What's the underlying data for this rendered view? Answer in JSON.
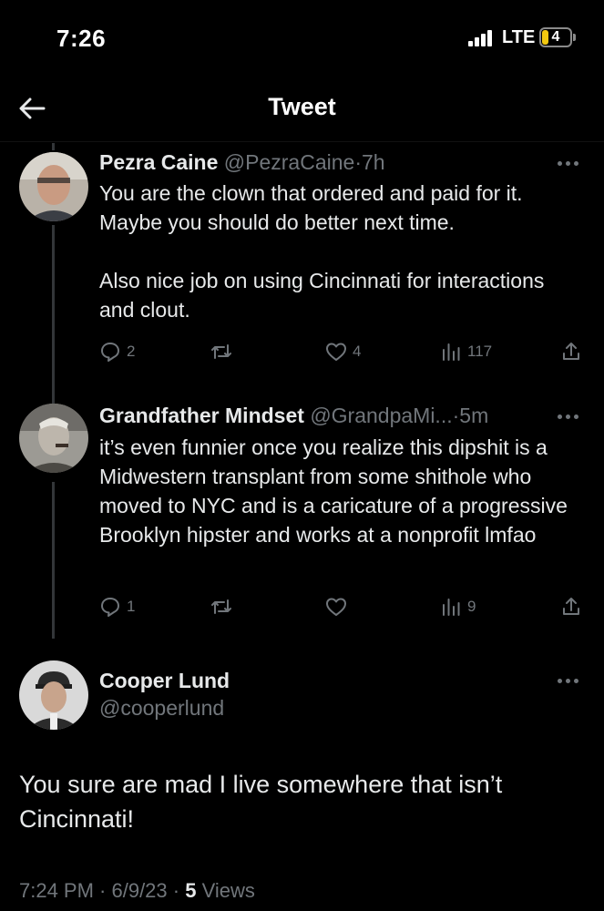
{
  "status_bar": {
    "time": "7:26",
    "network": "LTE",
    "battery": "4",
    "battery_color": "#f2c811"
  },
  "header": {
    "back_icon": "arrow-left-icon",
    "title": "Tweet"
  },
  "replies": [
    {
      "name": "Pezra Caine",
      "handle": "@PezraCaine",
      "time": "7h",
      "text": "You are the clown that ordered and paid for it. Maybe you should do better next time.\n\nAlso nice job on using Cincinnati for interactions and clout.",
      "replies": "2",
      "retweets": "",
      "likes": "4",
      "views": "117"
    },
    {
      "name": "Grandfather Mindset",
      "handle": "@GrandpaMi...",
      "time": "5m",
      "text": "it’s even funnier once you realize this dipshit is a Midwestern transplant from some shithole who moved to NYC and is a caricature of a progressive Brooklyn hipster and works at a nonprofit lmfao",
      "replies": "1",
      "retweets": "",
      "likes": "",
      "views": "9"
    }
  ],
  "main_tweet": {
    "name": "Cooper Lund",
    "handle": "@cooperlund",
    "text": "You sure are mad I live somewhere that isn’t Cincinnati!",
    "timestamp": "7:24 PM · 6/9/23 · ",
    "views_count": "5",
    "views_label": "Views"
  },
  "separator": "·"
}
